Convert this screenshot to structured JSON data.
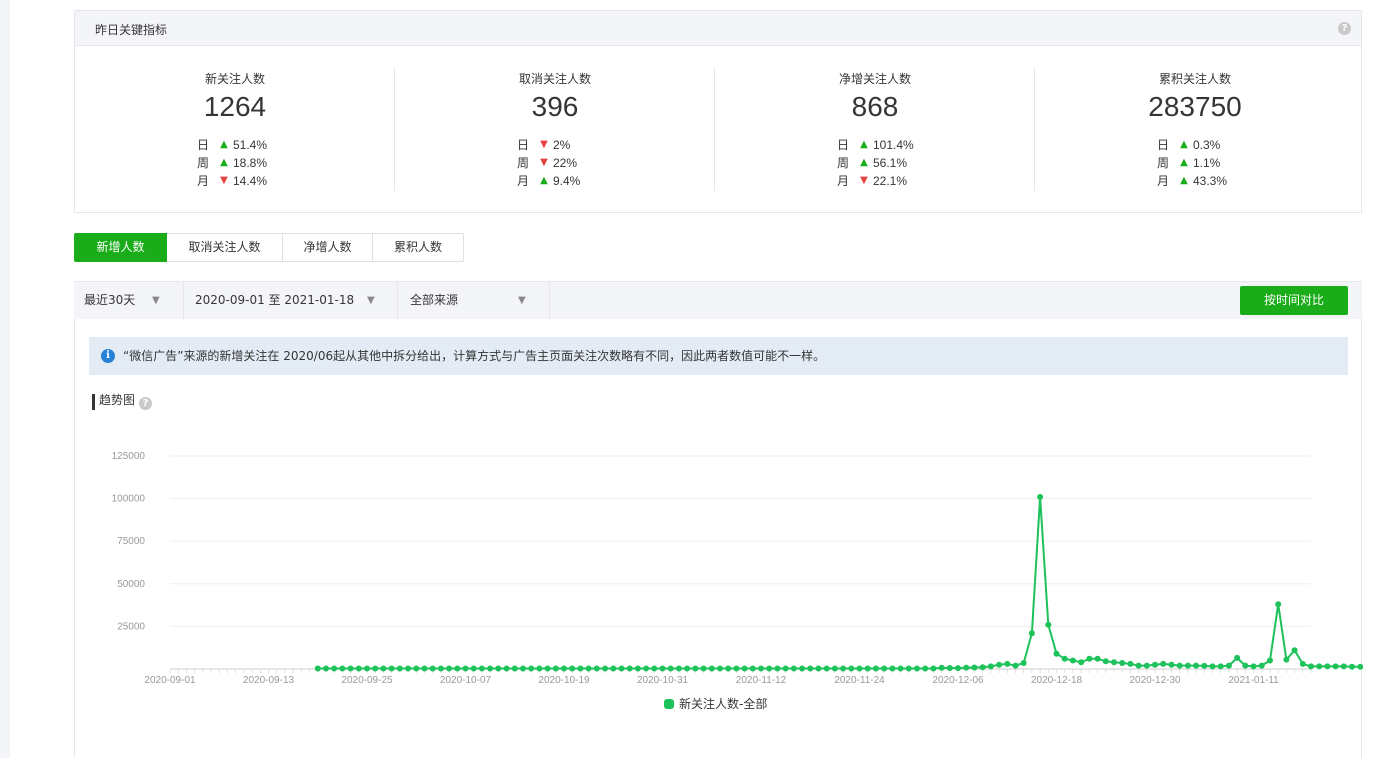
{
  "metrics_panel": {
    "title": "昨日关键指标",
    "cards": [
      {
        "label": "新关注人数",
        "value": "1264",
        "changes": [
          {
            "period": "日",
            "dir": "up",
            "pct": "51.4%"
          },
          {
            "period": "周",
            "dir": "up",
            "pct": "18.8%"
          },
          {
            "period": "月",
            "dir": "down",
            "pct": "14.4%"
          }
        ]
      },
      {
        "label": "取消关注人数",
        "value": "396",
        "changes": [
          {
            "period": "日",
            "dir": "down",
            "pct": "2%"
          },
          {
            "period": "周",
            "dir": "down",
            "pct": "22%"
          },
          {
            "period": "月",
            "dir": "up",
            "pct": "9.4%"
          }
        ]
      },
      {
        "label": "净增关注人数",
        "value": "868",
        "changes": [
          {
            "period": "日",
            "dir": "up",
            "pct": "101.4%"
          },
          {
            "period": "周",
            "dir": "up",
            "pct": "56.1%"
          },
          {
            "period": "月",
            "dir": "down",
            "pct": "22.1%"
          }
        ]
      },
      {
        "label": "累积关注人数",
        "value": "283750",
        "changes": [
          {
            "period": "日",
            "dir": "up",
            "pct": "0.3%"
          },
          {
            "period": "周",
            "dir": "up",
            "pct": "1.1%"
          },
          {
            "period": "月",
            "dir": "up",
            "pct": "43.3%"
          }
        ]
      }
    ]
  },
  "tabs": [
    {
      "label": "新增人数",
      "active": true
    },
    {
      "label": "取消关注人数",
      "active": false
    },
    {
      "label": "净增人数",
      "active": false
    },
    {
      "label": "累积人数",
      "active": false
    }
  ],
  "filters": {
    "range": "最近30天",
    "dates": "2020-09-01 至 2021-01-18",
    "source": "全部来源",
    "compare_button": "按时间对比"
  },
  "notice": "“微信广告”来源的新增关注在 2020/06起从其他中拆分给出，计算方式与广告主页面关注次数略有不同，因此两者数值可能不一样。",
  "trend_title": "趋势图",
  "colors": {
    "accent": "#1aad19",
    "up": "#1aad19",
    "down": "#e64340",
    "series": "#1dc25a"
  },
  "icons": {
    "help": "question-circle-icon",
    "info": "info-circle-icon",
    "up": "arrow-up-icon",
    "down": "arrow-down-icon",
    "caret": "caret-down-icon"
  },
  "chart_data": {
    "type": "line",
    "x_start": "2020-09-01",
    "x_end": "2021-01-18",
    "x_ticks": [
      "2020-09-01",
      "2020-09-13",
      "2020-09-25",
      "2020-10-07",
      "2020-10-19",
      "2020-10-31",
      "2020-11-12",
      "2020-11-24",
      "2020-12-06",
      "2020-12-18",
      "2020-12-30",
      "2021-01-11"
    ],
    "y_ticks": [
      25000,
      50000,
      75000,
      100000,
      125000
    ],
    "ylim": [
      0,
      125000
    ],
    "grid": true,
    "legend": "bottom",
    "series": [
      {
        "name": "新关注人数-全部",
        "first_date": "2020-09-19",
        "values": [
          300,
          300,
          300,
          300,
          300,
          300,
          300,
          300,
          300,
          300,
          300,
          300,
          300,
          300,
          300,
          300,
          300,
          300,
          300,
          300,
          300,
          300,
          300,
          300,
          300,
          300,
          300,
          300,
          300,
          300,
          300,
          300,
          300,
          300,
          300,
          300,
          300,
          300,
          300,
          300,
          300,
          300,
          300,
          300,
          300,
          300,
          300,
          300,
          300,
          300,
          300,
          300,
          300,
          300,
          300,
          300,
          300,
          300,
          300,
          300,
          300,
          300,
          300,
          300,
          300,
          300,
          300,
          300,
          300,
          300,
          300,
          300,
          300,
          300,
          300,
          300,
          700,
          600,
          500,
          800,
          900,
          1000,
          1500,
          2500,
          3000,
          2000,
          3500,
          21000,
          101000,
          26000,
          9000,
          6000,
          5000,
          4000,
          6000,
          6000,
          4500,
          4000,
          3500,
          3000,
          2000,
          2000,
          2500,
          3000,
          2500,
          2000,
          2000,
          2000,
          1800,
          1500,
          1500,
          2000,
          6500,
          2000,
          1500,
          2000,
          5000,
          38000,
          5500,
          11000,
          3000,
          1500,
          1500,
          1500,
          1500,
          1500,
          1300,
          1300,
          2500,
          1800,
          1800,
          2000
        ]
      }
    ]
  }
}
